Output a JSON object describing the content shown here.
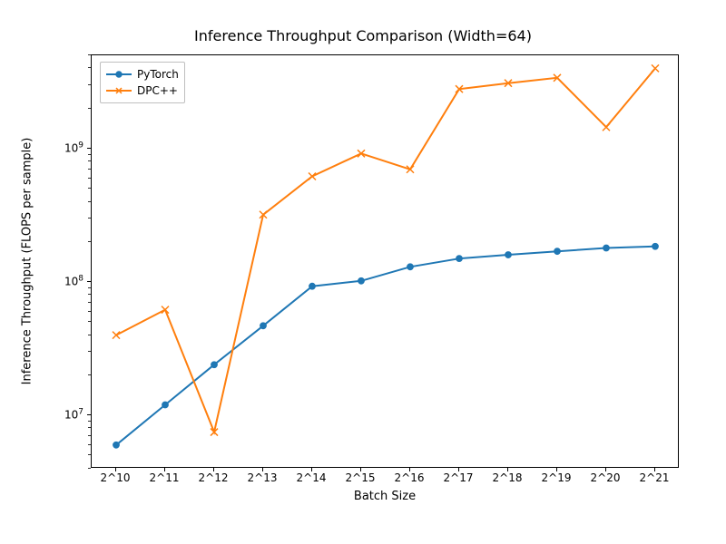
{
  "chart_data": {
    "type": "line",
    "title": "Inference Throughput Comparison (Width=64)",
    "xlabel": "Batch Size",
    "ylabel": "Inference Throughput (FLOPS per sample)",
    "categories": [
      "2^10",
      "2^11",
      "2^12",
      "2^13",
      "2^14",
      "2^15",
      "2^16",
      "2^17",
      "2^18",
      "2^19",
      "2^20",
      "2^21"
    ],
    "y_tick_labels": [
      "10^7",
      "10^8",
      "10^9"
    ],
    "y_tick_values": [
      10000000,
      100000000,
      1000000000
    ],
    "ylim_log10": [
      6.6,
      9.7
    ],
    "series": [
      {
        "name": "PyTorch",
        "marker": "circle",
        "color": "#1f77b4",
        "values": [
          6000000,
          12000000,
          24000000,
          47000000,
          93000000,
          102000000,
          130000000,
          150000000,
          160000000,
          170000000,
          180000000,
          185000000
        ]
      },
      {
        "name": "DPC++",
        "marker": "x",
        "color": "#ff7f0e",
        "values": [
          40000000,
          62000000,
          7500000,
          320000000,
          620000000,
          920000000,
          700000000,
          2800000000,
          3100000000,
          3400000000,
          1450000000,
          4000000000
        ]
      }
    ],
    "legend": {
      "position": "upper left"
    }
  }
}
